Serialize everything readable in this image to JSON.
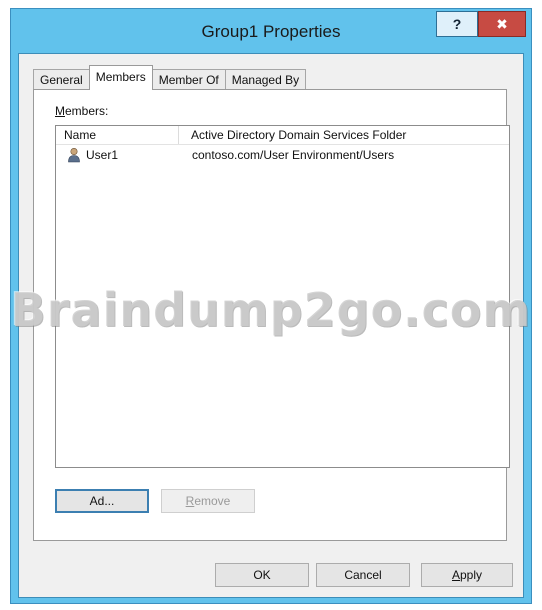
{
  "window": {
    "title": "Group1 Properties",
    "help_label": "?",
    "close_label": "✖"
  },
  "tabs": [
    {
      "label": "General"
    },
    {
      "label": "Members"
    },
    {
      "label": "Member Of"
    },
    {
      "label": "Managed By"
    }
  ],
  "active_tab": "Members",
  "members": {
    "label_rest": "embers:",
    "label_mnemonic": "M",
    "columns": [
      "Name",
      "Active Directory Domain Services Folder"
    ],
    "rows": [
      {
        "name": "User1",
        "folder": "contoso.com/User Environment/Users",
        "icon": "user-icon"
      }
    ]
  },
  "buttons": {
    "add_mnemonic": "d",
    "add_pre": "A",
    "add_post": "d...",
    "remove_mnemonic": "R",
    "remove_rest": "emove",
    "ok": "OK",
    "cancel": "Cancel",
    "apply_mnemonic": "A",
    "apply_rest": "pply"
  },
  "watermark": "Braindump2go.com",
  "colors": {
    "title_bar": "#61c2ec",
    "close_button": "#c74b43",
    "dialog_bg": "#f0f0f0",
    "default_button_border": "#3c7fb1"
  }
}
